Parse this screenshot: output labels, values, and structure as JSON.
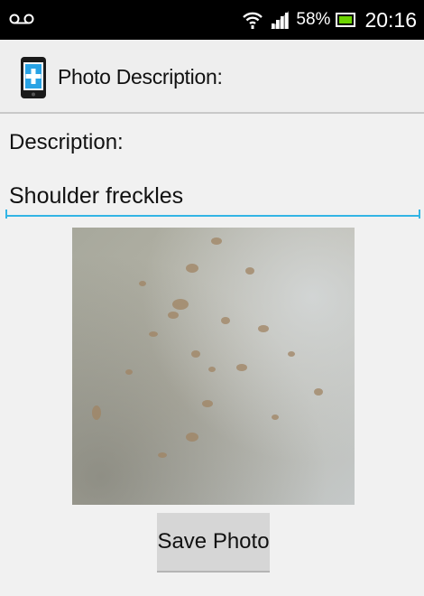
{
  "status_bar": {
    "battery_percent": "58%",
    "time": "20:16",
    "icons": [
      "voicemail-icon",
      "wifi-icon",
      "signal-icon",
      "battery-icon"
    ]
  },
  "action_bar": {
    "title": "Photo Description:",
    "app_icon": "phone-medical-icon"
  },
  "form": {
    "description_label": "Description:",
    "description_value": "Shoulder freckles",
    "photo_icon": "skin-photo",
    "save_label": "Save Photo"
  },
  "colors": {
    "accent": "#33b5e5",
    "status_bar": "#000000",
    "background": "#f1f1f1",
    "button": "#d6d6d6"
  }
}
